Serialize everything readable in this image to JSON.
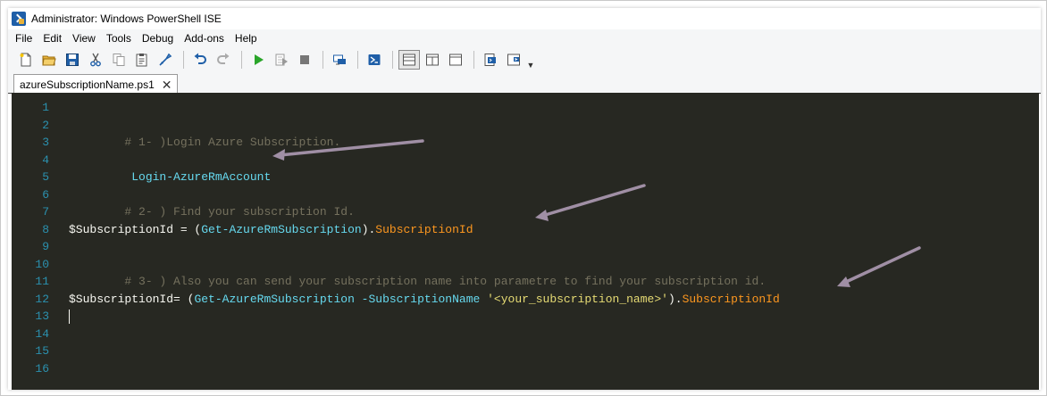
{
  "window": {
    "title": "Administrator: Windows PowerShell ISE"
  },
  "menu": [
    "File",
    "Edit",
    "View",
    "Tools",
    "Debug",
    "Add-ons",
    "Help"
  ],
  "toolbar": {
    "buttons": [
      "new-icon",
      "open-icon",
      "save-icon",
      "cut-icon",
      "copy-icon",
      "paste-icon",
      "clear-console-icon",
      "undo-icon",
      "redo-icon",
      "run-icon",
      "run-selection-icon",
      "stop-icon",
      "remote-powershell-icon",
      "start-powershell-icon",
      "show-script-top-icon",
      "show-script-right-icon",
      "show-script-maximized-icon",
      "show-command-window-icon",
      "show-command-addon-icon"
    ]
  },
  "tab": {
    "label": "azureSubscriptionName.ps1",
    "close": "✕"
  },
  "editor": {
    "line_numbers": [
      "1",
      "2",
      "3",
      "4",
      "5",
      "6",
      "7",
      "8",
      "9",
      "10",
      "11",
      "12",
      "13",
      "14",
      "15",
      "16"
    ],
    "lines": {
      "l2": "# 1- )Login Azure Subscription.",
      "l4_cmd": " Login-AzureRmAccount",
      "l6": "# 2- ) Find your subscription Id.",
      "l8_var": "$SubscriptionId",
      "l8_op": " = (",
      "l8_cmd": "Get-AzureRmSubscription",
      "l8_close": ").",
      "l8_prop": "SubscriptionId",
      "l10": "# 3- ) Also you can send your subscription name into parametre to find your subscription id.",
      "l12_var": "$SubscriptionId",
      "l12_op": "= (",
      "l12_cmd": "Get-AzureRmSubscription",
      "l12_param": " -SubscriptionName ",
      "l12_str": "'<your_subscription_name>'",
      "l12_close": ").",
      "l12_prop": "SubscriptionId"
    }
  },
  "colors": {
    "editor_bg": "#272822",
    "line_number": "#2b91af",
    "comment": "#75715e",
    "command": "#66d9ef",
    "string": "#e6db74",
    "property": "#fd971f",
    "arrow": "#a08fa5"
  }
}
